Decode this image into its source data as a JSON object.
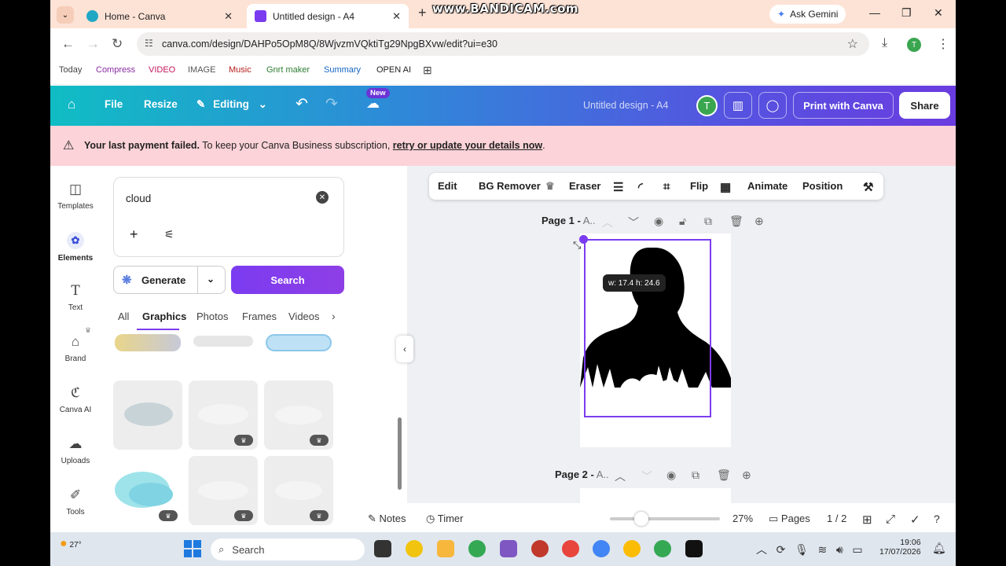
{
  "watermark": "www.BANDICAM.com",
  "browser": {
    "tabs": [
      {
        "title": "Home - Canva"
      },
      {
        "title": "Untitled design - A4"
      }
    ],
    "gemini": "Ask Gemini",
    "url": "canva.com/design/DAHPo5OpM8Q/8WjvzmVQktiTg29NpgBXvw/edit?ui=e30",
    "profile": "T",
    "bookmarks": [
      "Today",
      "Compress",
      "VIDEO",
      "IMAGE",
      "Music",
      "Gnrt maker",
      "Summary",
      "OPEN AI"
    ]
  },
  "header": {
    "file": "File",
    "resize": "Resize",
    "editing": "Editing",
    "new_badge": "New",
    "doc_title": "Untitled design - A4",
    "avatar": "T",
    "print": "Print with Canva",
    "share": "Share"
  },
  "banner": {
    "bold": "Your last payment failed.",
    "text": " To keep your Canva Business subscription, ",
    "link": "retry or update your details now",
    "end": "."
  },
  "rail": [
    "Templates",
    "Elements",
    "Text",
    "Brand",
    "Canva AI",
    "Uploads",
    "Tools"
  ],
  "panel": {
    "search_value": "cloud",
    "generate": "Generate",
    "search": "Search",
    "tabs": [
      "All",
      "Graphics",
      "Photos",
      "Frames",
      "Videos"
    ]
  },
  "toolbar": [
    "Edit",
    "BG Remover",
    "Eraser",
    "Flip",
    "Animate",
    "Position"
  ],
  "canvas": {
    "page1_label": "Page 1 -",
    "page1_suffix": " A..",
    "page2_label": "Page 2 -",
    "page2_suffix": " A..",
    "dimensions": "w: 17.4 h: 24.6"
  },
  "bottom": {
    "notes": "Notes",
    "timer": "Timer",
    "zoom": "27%",
    "pages": "Pages",
    "page_count": "1 / 2"
  },
  "taskbar": {
    "temp": "27°",
    "search": "Search",
    "time": "19:06",
    "date": "17/07/2026"
  }
}
